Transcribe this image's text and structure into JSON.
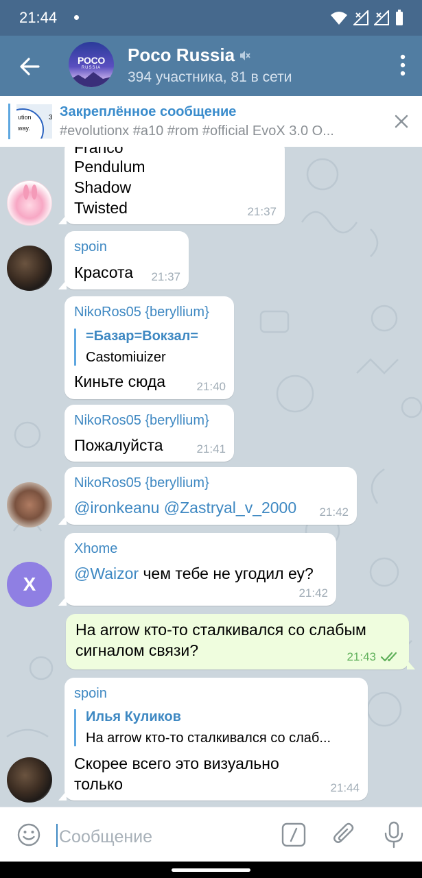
{
  "status_bar": {
    "time": "21:44"
  },
  "header": {
    "title": "Poco Russia",
    "subtitle": "394 участника, 81 в сети",
    "avatar_logo": "POCO",
    "avatar_sub": "RUSSIA"
  },
  "pinned": {
    "title": "Закреплённое сообщение",
    "text": "#evolutionx #a10 #rom #official  EvoX 3.0 O...",
    "thumb_lines": [
      "ution",
      "way.",
      "3"
    ]
  },
  "messages": [
    {
      "type": "in",
      "lines": [
        "Franco",
        "Pendulum",
        "Shadow",
        "Twisted"
      ],
      "time": "21:37"
    },
    {
      "type": "in",
      "sender": "spoin",
      "text": "Красота",
      "time": "21:37"
    },
    {
      "type": "in",
      "sender": "NikoRos05 {beryllium}",
      "reply_name": "=Базар=Вокзал=",
      "reply_text": "Castomiuizer",
      "text": "Киньте сюда",
      "time": "21:40"
    },
    {
      "type": "in",
      "sender": "NikoRos05 {beryllium}",
      "text": "Пожалуйста",
      "time": "21:41"
    },
    {
      "type": "in",
      "sender": "NikoRos05 {beryllium}",
      "mentions": "@ironkeanu @Zastryal_v_2000",
      "time": "21:42"
    },
    {
      "type": "in",
      "sender": "Xhome",
      "mention": "@Waizor",
      "text": " чем тебе не угодил еу?",
      "time": "21:42",
      "avatar_letter": "X"
    },
    {
      "type": "out",
      "lines": [
        "На arrow кто-то сталкивался со слабым",
        "сигналом связи?"
      ],
      "time": "21:43"
    },
    {
      "type": "in",
      "sender": "spoin",
      "reply_name": "Илья Куликов",
      "reply_text": "На arrow кто-то сталкивался со слаб...",
      "lines": [
        "Скорее всего это визуально",
        "только"
      ],
      "time": "21:44"
    }
  ],
  "input": {
    "placeholder": "Сообщение"
  },
  "colors": {
    "header": "#517da2",
    "statusbar": "#46698d",
    "accent": "#3e88c2",
    "outgoing_bubble": "#effdde"
  }
}
